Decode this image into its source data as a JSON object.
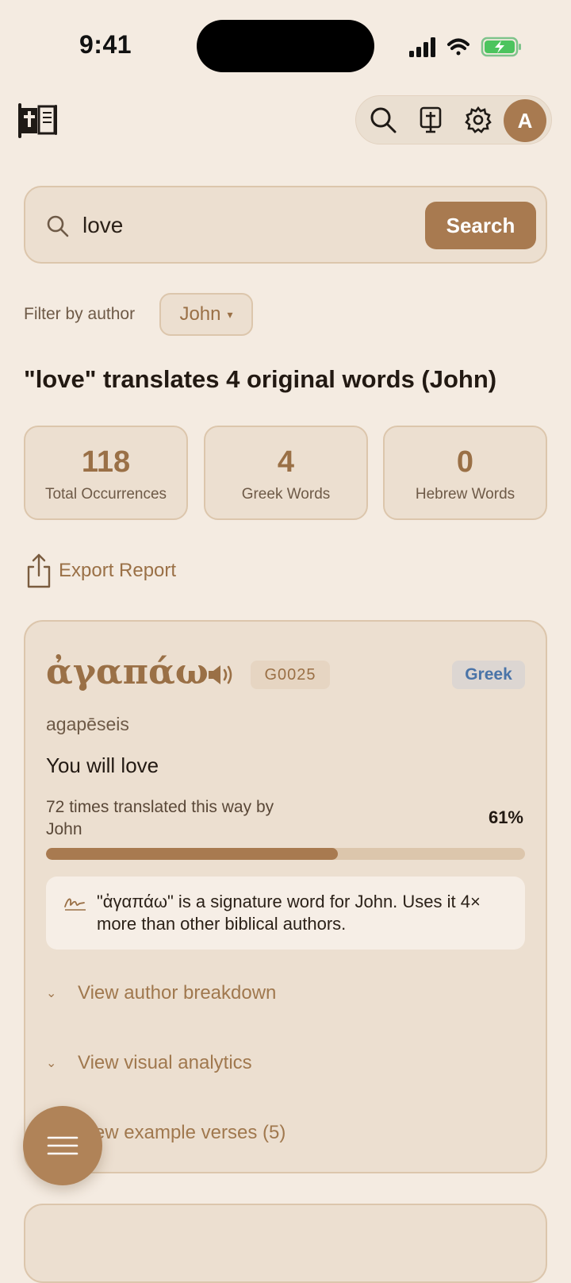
{
  "status": {
    "time": "9:41"
  },
  "toolbar": {
    "icons": [
      "search-icon",
      "bible-cross-icon",
      "gear-icon"
    ],
    "avatar_initial": "A"
  },
  "search": {
    "value": "love",
    "placeholder": "",
    "button_label": "Search"
  },
  "filter": {
    "label": "Filter by author",
    "selected": "John",
    "caret": "▾"
  },
  "results": {
    "headline": "\"love\" translates 4 original words (John)",
    "stats": [
      {
        "value": "118",
        "label": "Total Occurrences"
      },
      {
        "value": "4",
        "label": "Greek Words"
      },
      {
        "value": "0",
        "label": "Hebrew Words"
      }
    ],
    "export_label": "Export Report"
  },
  "card": {
    "word": "ἀγαπάω",
    "strongs": "G0025",
    "language": "Greek",
    "transliteration": "agapēseis",
    "gloss": "You will love",
    "frequency_text": "72 times translated this way by John",
    "percent_label": "61%",
    "percent_value": 61,
    "note": "\"ἀγαπάω\" is a signature word for John. Uses it 4× more than other biblical authors.",
    "expanders": [
      {
        "label": "View author breakdown"
      },
      {
        "label": "View visual analytics"
      },
      {
        "label": "View example verses (5)"
      }
    ],
    "chevron": "⌄"
  },
  "colors": {
    "accent": "#a87a50",
    "background": "#f4ebe1",
    "card": "#ecdfd0",
    "greek_badge_text": "#4a74a8"
  }
}
